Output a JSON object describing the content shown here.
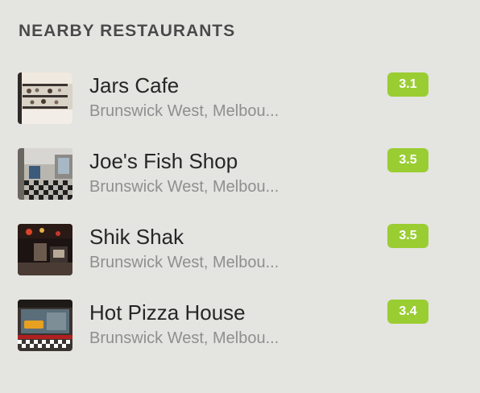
{
  "section": {
    "title": "NEARBY RESTAURANTS"
  },
  "restaurants": [
    {
      "name": "Jars Cafe",
      "location": "Brunswick West, Melbou...",
      "rating": "3.1",
      "thumb_icon": "cafe-photo"
    },
    {
      "name": "Joe's Fish Shop",
      "location": "Brunswick West, Melbou...",
      "rating": "3.5",
      "thumb_icon": "fish-shop-photo"
    },
    {
      "name": "Shik Shak",
      "location": "Brunswick West, Melbou...",
      "rating": "3.5",
      "thumb_icon": "shik-shak-photo"
    },
    {
      "name": "Hot Pizza House",
      "location": "Brunswick West, Melbou...",
      "rating": "3.4",
      "thumb_icon": "pizza-house-photo"
    }
  ],
  "colors": {
    "background": "#e4e4e1",
    "rating_badge": "#9acd32",
    "name_text": "#262626",
    "location_text": "#8f8f8f",
    "heading_text": "#4a4a4a"
  }
}
